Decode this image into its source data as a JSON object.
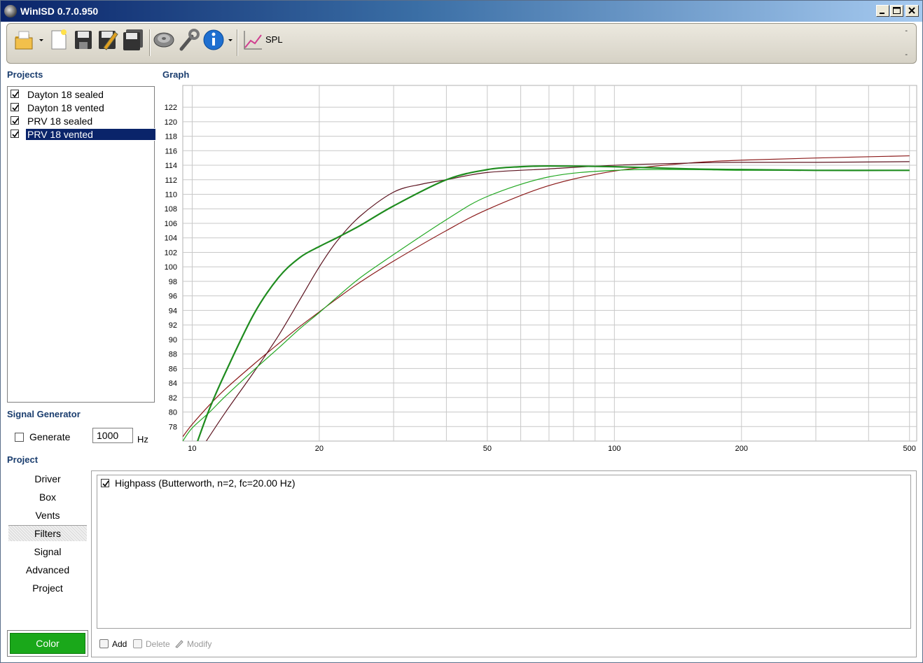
{
  "window": {
    "title": "WinISD 0.7.0.950"
  },
  "toolbar": {
    "icons": [
      "open-folder-icon",
      "new-document-icon",
      "save-icon",
      "save-as-icon",
      "save-all-icon",
      "driver-speaker-icon",
      "tools-wrench-icon",
      "info-icon",
      "spl-graph-icon"
    ],
    "spl_label": "SPL",
    "dots": [
      "-",
      "-"
    ]
  },
  "projects": {
    "heading": "Projects",
    "items": [
      {
        "label": "Dayton 18 sealed",
        "checked": true,
        "selected": false
      },
      {
        "label": "Dayton 18 vented",
        "checked": true,
        "selected": false
      },
      {
        "label": "PRV 18 sealed",
        "checked": true,
        "selected": false
      },
      {
        "label": "PRV 18 vented",
        "checked": true,
        "selected": true
      }
    ]
  },
  "signal_generator": {
    "heading": "Signal Generator",
    "generate_label": "Generate",
    "generate_checked": false,
    "frequency": "1000",
    "unit": "Hz"
  },
  "graph": {
    "heading": "Graph"
  },
  "project_panel": {
    "heading": "Project",
    "nav": [
      "Driver",
      "Box",
      "Vents",
      "Filters",
      "Signal",
      "Advanced",
      "Project"
    ],
    "active": "Filters",
    "filters": [
      {
        "label": "Highpass (Butterworth, n=2, fc=20.00 Hz)",
        "checked": true
      }
    ],
    "actions": {
      "add": "Add",
      "delete": "Delete",
      "modify": "Modify"
    },
    "color_label": "Color",
    "color_value": "#1aa81a"
  },
  "chart_data": {
    "type": "line",
    "title": "",
    "xlabel": "",
    "ylabel": "",
    "x_scale": "log",
    "xlim": [
      9.5,
      520
    ],
    "ylim": [
      76,
      125
    ],
    "x_ticks": [
      10,
      20,
      50,
      100,
      200,
      500
    ],
    "y_ticks": [
      78,
      80,
      82,
      84,
      86,
      88,
      90,
      92,
      94,
      96,
      98,
      100,
      102,
      104,
      106,
      108,
      110,
      112,
      114,
      116,
      118,
      120,
      122
    ],
    "grid": true,
    "legend": "none",
    "series": [
      {
        "color": "#8b1a1a",
        "x": [
          9.5,
          10,
          11,
          12,
          14,
          16,
          18,
          20,
          22,
          25,
          30,
          40,
          50,
          70,
          100,
          150,
          200,
          300,
          500
        ],
        "y": [
          76.6,
          78.3,
          81.0,
          83.2,
          86.6,
          89.4,
          91.8,
          93.8,
          95.6,
          97.9,
          100.8,
          105.0,
          107.9,
          111.2,
          113.2,
          114.3,
          114.7,
          115.0,
          115.3
        ]
      },
      {
        "color": "#5c1420",
        "x": [
          10.8,
          12,
          14,
          16,
          18,
          20,
          22,
          25,
          30,
          35,
          40,
          50,
          70,
          100,
          150,
          200,
          300,
          500
        ],
        "y": [
          76,
          80,
          85.5,
          90.5,
          95.5,
          100,
          103.5,
          107,
          110.3,
          111.4,
          112,
          113,
          113.5,
          114,
          114.3,
          114.4,
          114.4,
          114.5
        ]
      },
      {
        "color": "#22a822",
        "x": [
          9.5,
          10,
          11,
          12,
          14,
          16,
          18,
          20,
          22,
          25,
          30,
          40,
          50,
          70,
          100,
          150,
          200,
          300,
          500
        ],
        "y": [
          76,
          77.8,
          80.0,
          82.2,
          85.8,
          88.8,
          91.5,
          93.7,
          95.8,
          98.5,
          101.7,
          106.5,
          109.7,
          112.4,
          113.3,
          113.4,
          113.3,
          113.3,
          113.3
        ]
      },
      {
        "color": "#1f8c1f",
        "x": [
          10.3,
          11,
          12,
          14,
          16,
          18,
          20,
          22,
          25,
          30,
          40,
          50,
          60,
          70,
          100,
          150,
          200,
          300,
          500
        ],
        "y": [
          76,
          80.5,
          85.5,
          93.5,
          98.5,
          101.3,
          102.8,
          104,
          105.7,
          108.4,
          112,
          113.4,
          113.8,
          113.9,
          113.8,
          113.5,
          113.4,
          113.3,
          113.3
        ]
      }
    ]
  },
  "colors": {
    "title_gradient_start": "#0a246a",
    "selection": "#0a246a",
    "heading": "#1a3d6e",
    "grid": "#c8c8c8"
  }
}
